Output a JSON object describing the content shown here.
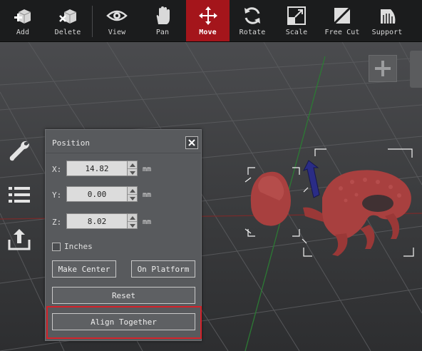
{
  "toolbar": {
    "tools": [
      {
        "label": "Add",
        "icon": "add-model-icon"
      },
      {
        "label": "Delete",
        "icon": "delete-model-icon"
      },
      {
        "label": "View",
        "icon": "eye-icon"
      },
      {
        "label": "Pan",
        "icon": "hand-icon"
      },
      {
        "label": "Move",
        "icon": "move-arrows-icon",
        "active": true
      },
      {
        "label": "Rotate",
        "icon": "rotate-icon"
      },
      {
        "label": "Scale",
        "icon": "scale-icon"
      },
      {
        "label": "Free Cut",
        "icon": "free-cut-icon"
      },
      {
        "label": "Support",
        "icon": "support-icon"
      }
    ]
  },
  "sidebar": {
    "items": [
      {
        "icon": "wrench-icon"
      },
      {
        "icon": "list-icon"
      },
      {
        "icon": "export-icon"
      }
    ]
  },
  "position_panel": {
    "title": "Position",
    "x_label": "X:",
    "x_value": "14.82",
    "y_label": "Y:",
    "y_value": "0.00",
    "z_label": "Z:",
    "z_value": "8.02",
    "unit": "mm",
    "inches_label": "Inches",
    "inches_checked": false,
    "make_center_label": "Make Center",
    "on_platform_label": "On Platform",
    "reset_label": "Reset",
    "align_together_label": "Align Together"
  },
  "colors": {
    "toolbar_bg": "#1b1c1d",
    "active_tool": "#a4151b",
    "model_color": "#a8403f",
    "highlight_border": "#d3222a"
  }
}
